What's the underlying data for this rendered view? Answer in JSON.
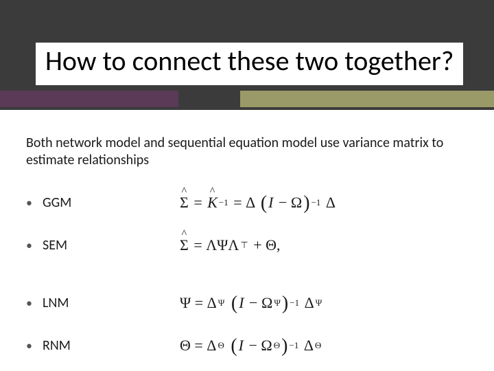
{
  "title": "How to connect these two together?",
  "intro": "Both network model and sequential equation model use variance matrix to estimate relationships",
  "items": [
    {
      "label": "GGM",
      "formula_key": "ggm"
    },
    {
      "label": "SEM",
      "formula_key": "sem"
    },
    {
      "label": "LNM",
      "formula_key": "lnm"
    },
    {
      "label": "RNM",
      "formula_key": "rnm"
    }
  ],
  "formulas": {
    "ggm": "Σ̂ = K̂⁻¹ = Δ (I − Ω)⁻¹ Δ",
    "sem": "Σ̂ = Λ Ψ Λᵀ + Θ,",
    "lnm": "Ψ = Δ_Ψ (I − Ω_Ψ)⁻¹ Δ_Ψ",
    "rnm": "Θ = Δ_Θ (I − Ω_Θ)⁻¹ Δ_Θ"
  },
  "colors": {
    "header_bg": "#3b3b3b",
    "accent_left": "#5a3a56",
    "accent_right": "#9a9a68"
  }
}
